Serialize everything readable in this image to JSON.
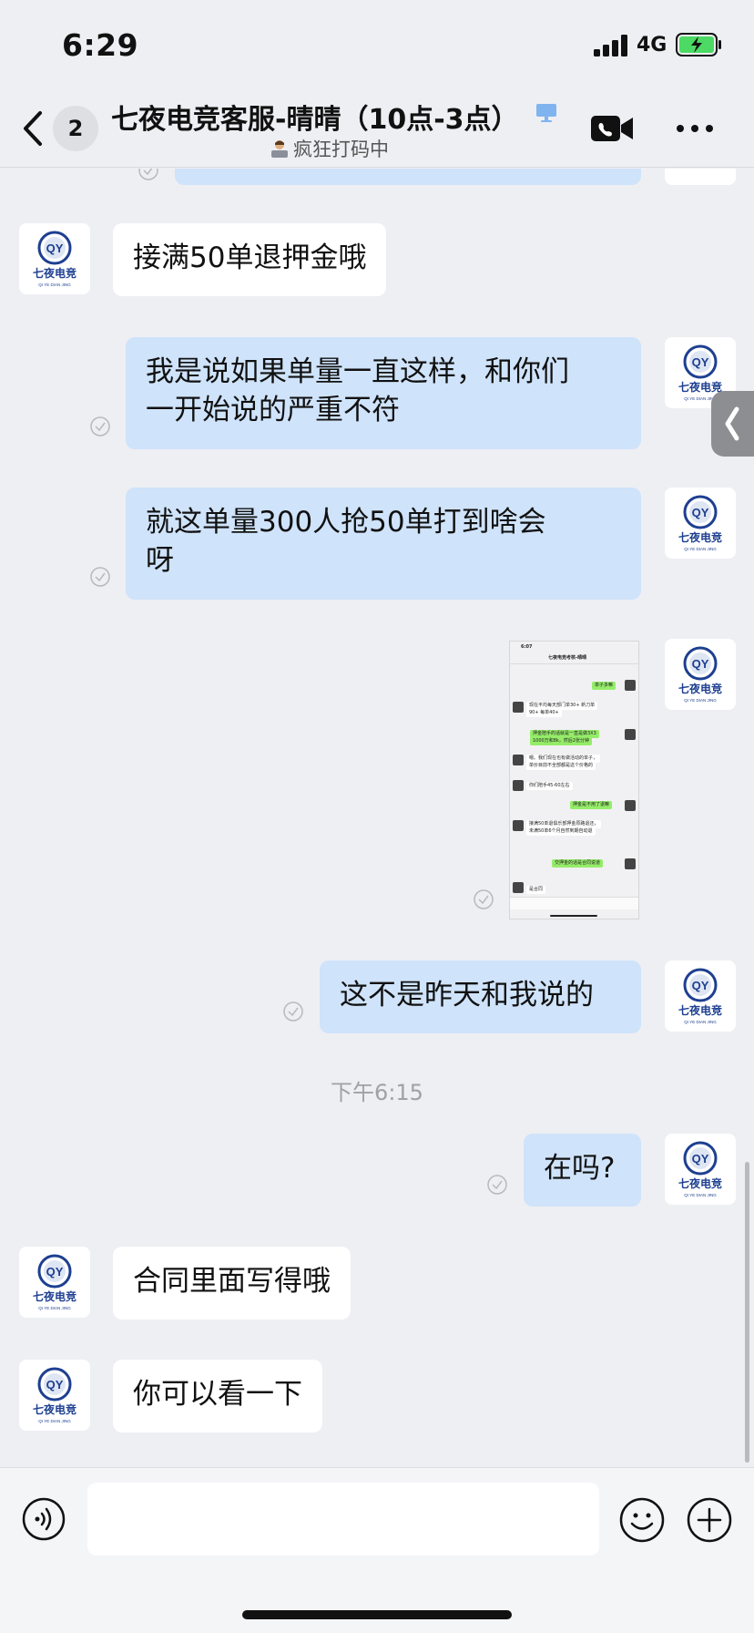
{
  "status_bar": {
    "time": "6:29",
    "network": "4G"
  },
  "header": {
    "unread_count": "2",
    "title": "七夜电竞客服-晴晴（10点-3点）",
    "status_text": "疯狂打码中"
  },
  "messages": [
    {
      "side": "in",
      "text": "接满50单退押金哦"
    },
    {
      "side": "out",
      "lines": [
        "我是说如果单量一直这样，和你们",
        "一开始说的严重不符"
      ]
    },
    {
      "side": "out",
      "lines": [
        "就这单量300人抢50单打到啥会",
        "呀"
      ]
    },
    {
      "side": "out",
      "type": "image"
    },
    {
      "side": "out",
      "text": "这不是昨天和我说的"
    },
    {
      "side": "out",
      "text": "在吗?"
    },
    {
      "side": "in",
      "text": "合同里面写得哦"
    },
    {
      "side": "in",
      "text": "你可以看一下"
    }
  ],
  "timestamp": "下午6:15",
  "avatar": {
    "letters": "QY",
    "brand": "七夜电竞",
    "sub": "QI YE DIAN JING",
    "color": "#1d3f91"
  },
  "thumbnail": {
    "time": "6:07",
    "title": "七夜电竞考核-晴晴",
    "rows": [
      "单子多嘛",
      "现在平均每天部门单30+ 新刀单",
      "90+ 每单40+",
      "押金陪手的话就是一直是做3X3",
      "1000万和8k，然后2张分钟",
      "嗯。我们现在也有做活动的单子，",
      "单价目前不全部都是这个价格的",
      "你们陪手45-60左右",
      "押金是不用了退嘛",
      "接满50单退俱乐部押金原路退还，",
      "未满50单6个月自然到期自动退",
      "交押金的话是合同说道",
      "是合同"
    ]
  },
  "input": {
    "placeholder": ""
  }
}
